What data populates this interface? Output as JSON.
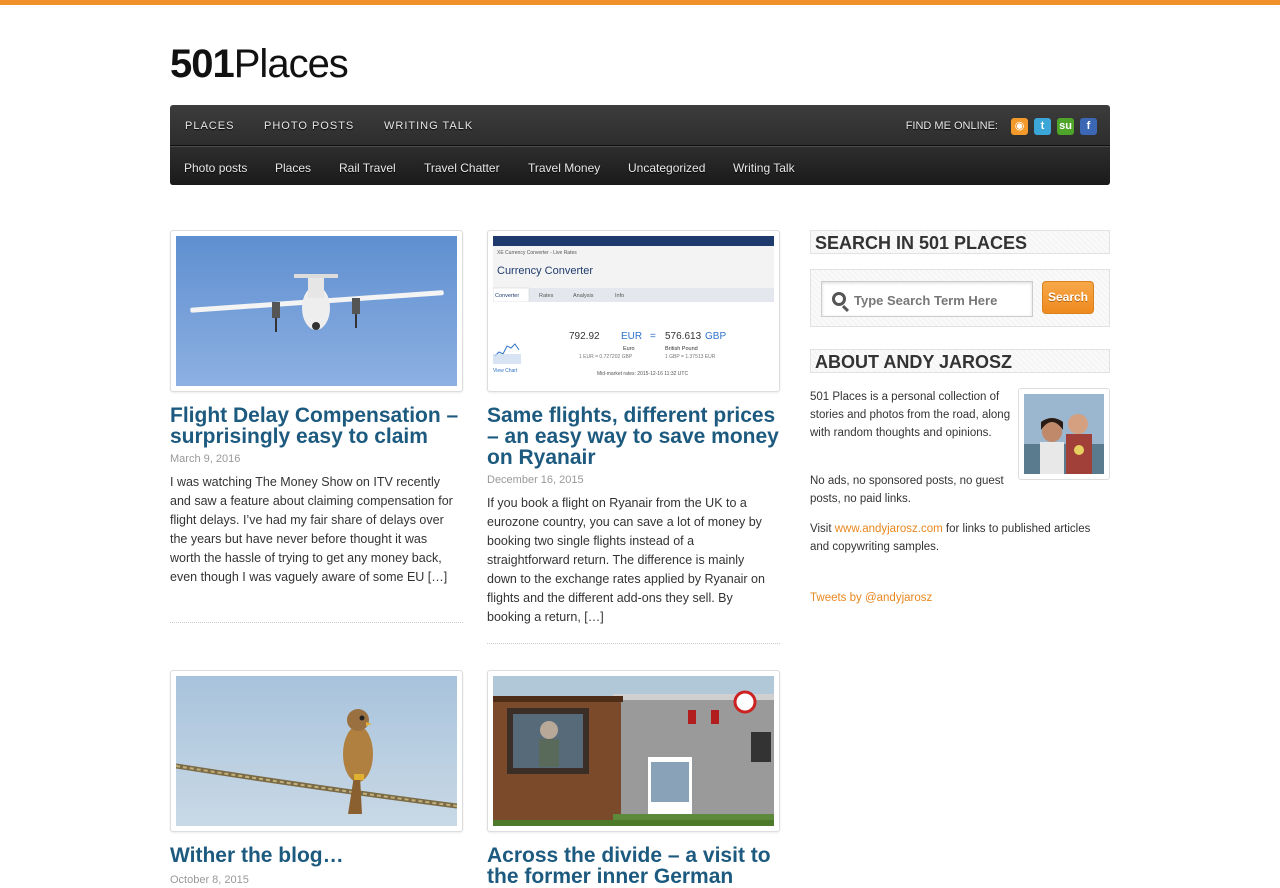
{
  "site": {
    "logo_num": "501",
    "logo_word": "Places"
  },
  "nav": {
    "main": [
      "Places",
      "Photo Posts",
      "Writing Talk"
    ],
    "find_label": "FIND ME ONLINE:",
    "social_icons": [
      "rss-icon",
      "twitter-icon",
      "stumbleupon-icon",
      "facebook-icon"
    ],
    "sub": [
      "Photo posts",
      "Places",
      "Rail Travel",
      "Travel Chatter",
      "Travel Money",
      "Uncategorized",
      "Writing Talk"
    ]
  },
  "posts": [
    {
      "title": "Flight Delay Compensation – surprisingly easy to claim",
      "date": "March 9, 2016",
      "excerpt": "I was watching The Money Show on ITV recently and saw a feature about claiming compensation for flight delays. I’ve had my fair share of delays over the years but have never before thought it was worth the hassle of trying to get any money back, even though I was vaguely aware of some EU […]",
      "image": "small propeller airplane in blue sky"
    },
    {
      "title": "Same flights, different prices – an easy way to save money on Ryanair",
      "date": "December 16, 2015",
      "excerpt": "If you book a flight on Ryanair from the UK to a eurozone country, you can save a lot of money by booking two single flights instead of a straightforward return. The difference is mainly down to the exchange rates applied by Ryanair on flights and the different add-ons they sell. By booking a return, […]",
      "image": "currency converter screenshot",
      "screenshot": {
        "header": "XE Currency Converter - Live Rates",
        "title": "Currency Converter",
        "tabs": [
          "Converter",
          "Rates",
          "Analysis",
          "Info"
        ],
        "amount_from": "792.92",
        "cur_from": "EUR",
        "amount_to": "576.613",
        "cur_to": "GBP",
        "name_from": "Euro",
        "name_to": "British Pound",
        "rate_from": "1 EUR = 0.727202 GBP",
        "rate_to": "1 GBP = 1.37513 EUR",
        "mid": "Mid-market rates: 2015-12-16 11:32 UTC",
        "chart": "View Chart"
      }
    },
    {
      "title": "Wither the blog…",
      "date": "October 8, 2015",
      "image": "kestrel perched on a rope"
    },
    {
      "title": "Across the divide – a visit to the former inner German",
      "date": "",
      "image": "wooden guard hut with mannequin and sign"
    }
  ],
  "sidebar": {
    "search_title": "Search in 501 Places",
    "search_placeholder": "Type Search Term Here",
    "search_button": "Search",
    "about_title": "About Andy Jarosz",
    "about_p1": "501 Places is a personal collection of stories and photos from the road, along with random thoughts and opinions.",
    "about_p2": "No ads, no sponsored posts, no guest posts, no paid links.",
    "about_p3_pre": "Visit ",
    "about_p3_link": "www.andyjarosz.com",
    "about_p3_post": " for links to published articles and copywriting samples.",
    "tweets": "Tweets by @andyjarosz"
  },
  "colors": {
    "accent": "#f0902a",
    "title_blue": "#1d5a7f",
    "link_orange": "#e8871e"
  }
}
